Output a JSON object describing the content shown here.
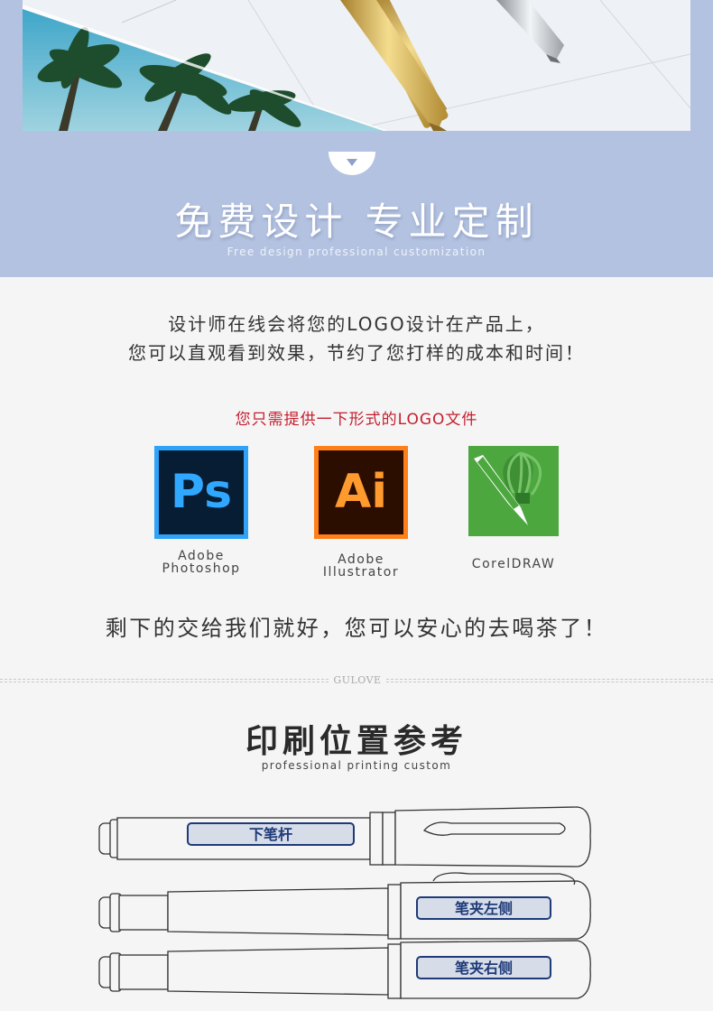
{
  "hero": {
    "title": "免费设计 专业定制",
    "subtitle": "Free design professional customization"
  },
  "intro": {
    "line1": "设计师在线会将您的LOGO设计在产品上，",
    "line2": "您可以直观看到效果，节约了您打样的成本和时间！"
  },
  "formats_prompt": "您只需提供一下形式的LOGO文件",
  "formats": [
    {
      "icon": "photoshop-icon",
      "icon_text": "Ps",
      "label": "Adobe\nPhotoshop"
    },
    {
      "icon": "illustrator-icon",
      "icon_text": "Ai",
      "label": "Adobe\nIllustrator"
    },
    {
      "icon": "coreldraw-icon",
      "label": "CorelDRAW"
    }
  ],
  "closing": "剩下的交给我们就好，您可以安心的去喝茶了！",
  "divider_brand": "GULOVE",
  "print_section": {
    "title": "印刷位置参考",
    "subtitle": "professional printing custom",
    "positions": [
      "下笔杆",
      "笔夹左侧",
      "笔夹右侧"
    ]
  },
  "colors": {
    "hero_bg": "#b3c2e0",
    "accent_red": "#c41f2f",
    "label_blue": "#1e3a78"
  }
}
